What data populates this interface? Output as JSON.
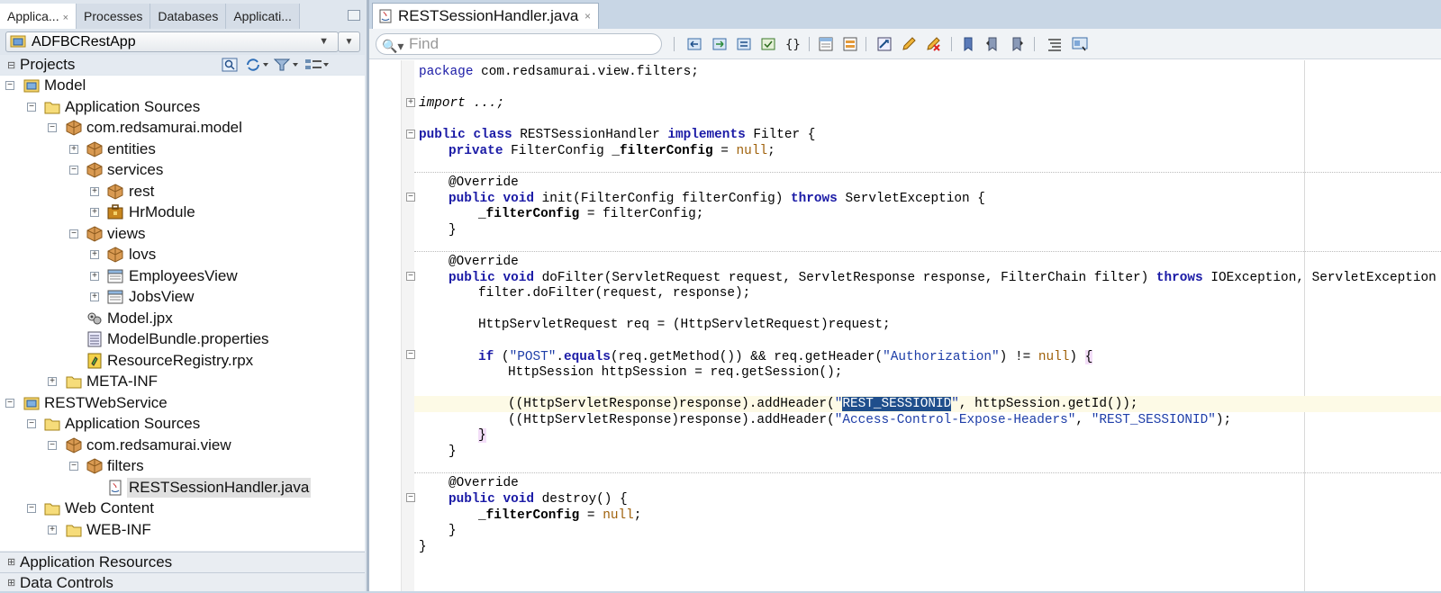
{
  "left_panel": {
    "tabs": [
      {
        "label": "Applica...",
        "active": true
      },
      {
        "label": "Processes"
      },
      {
        "label": "Databases"
      },
      {
        "label": "Applicati..."
      }
    ],
    "close_glyph": "×",
    "app_selector": "ADFBCRestApp",
    "projects_label": "Projects",
    "tree": [
      {
        "label": "Model",
        "icon": "project-icon",
        "expanded": true
      },
      {
        "label": "Application Sources",
        "icon": "folder-icon",
        "expanded": true
      },
      {
        "label": "com.redsamurai.model",
        "icon": "package-icon",
        "expanded": true
      },
      {
        "label": "entities",
        "icon": "package-icon",
        "expanded": false
      },
      {
        "label": "services",
        "icon": "package-icon",
        "expanded": true
      },
      {
        "label": "rest",
        "icon": "package-icon",
        "expanded": false
      },
      {
        "label": "HrModule",
        "icon": "app-module-icon",
        "expanded": false
      },
      {
        "label": "views",
        "icon": "package-icon",
        "expanded": true
      },
      {
        "label": "lovs",
        "icon": "package-icon",
        "expanded": false
      },
      {
        "label": "EmployeesView",
        "icon": "view-object-icon",
        "expanded": false
      },
      {
        "label": "JobsView",
        "icon": "view-object-icon",
        "expanded": false
      },
      {
        "label": "Model.jpx",
        "icon": "jpx-icon"
      },
      {
        "label": "ModelBundle.properties",
        "icon": "properties-icon"
      },
      {
        "label": "ResourceRegistry.rpx",
        "icon": "rpx-icon"
      },
      {
        "label": "META-INF",
        "icon": "folder-icon",
        "expanded": false
      },
      {
        "label": "RESTWebService",
        "icon": "project-icon",
        "expanded": true
      },
      {
        "label": "Application Sources",
        "icon": "folder-icon",
        "expanded": true
      },
      {
        "label": "com.redsamurai.view",
        "icon": "package-icon",
        "expanded": true
      },
      {
        "label": "filters",
        "icon": "package-icon",
        "expanded": true
      },
      {
        "label": "RESTSessionHandler.java",
        "icon": "java-file-icon",
        "selected": true
      },
      {
        "label": "Web Content",
        "icon": "folder-icon",
        "expanded": true
      },
      {
        "label": "WEB-INF",
        "icon": "folder-icon",
        "expanded": false
      }
    ],
    "bottom_sections": [
      "Application Resources",
      "Data Controls"
    ]
  },
  "editor": {
    "tab_label": "RESTSessionHandler.java",
    "find_placeholder": "Find",
    "code": {
      "l1_kw": "package",
      "l1_rest": " com.redsamurai.view.filters;",
      "l2": "import ...;",
      "l3_kw1": "public class",
      "l3_mid": " RESTSessionHandler ",
      "l3_kw2": "implements",
      "l3_end": " Filter {",
      "l4_kw": "private",
      "l4_type": " FilterConfig ",
      "l4_field": "_filterConfig",
      "l4_eq": " = ",
      "l4_null": "null",
      "l4_end": ";",
      "ann": "@Override",
      "l6_kw": "public void",
      "l6_mid": " init(FilterConfig filterConfig) ",
      "l6_kw2": "throws",
      "l6_end": " ServletException {",
      "l7_field": "_filterConfig",
      "l7_end": " = filterConfig;",
      "close": "}",
      "l10_kw": "public void",
      "l10_mid": " doFilter(ServletRequest request, ServletResponse response, FilterChain filter) ",
      "l10_kw2": "throws",
      "l10_end": " IOException, ServletException {",
      "l11": "filter.doFilter(request, response);",
      "l12": "HttpServletRequest req = (HttpServletRequest)request;",
      "l13_kw": "if",
      "l13_a": " (",
      "l13_s1": "\"POST\"",
      "l13_dot": ".",
      "l13_eq": "equals",
      "l13_b": "(req.getMethod()) && req.getHeader(",
      "l13_s2": "\"Authorization\"",
      "l13_c": ") != ",
      "l13_null": "null",
      "l13_d": ") ",
      "l13_brace": "{",
      "l14": "HttpSession httpSession = req.getSession();",
      "l15_a": "((HttpServletResponse)response).addHeader(",
      "l15_q1": "\"",
      "l15_sel": "REST_SESSIONID",
      "l15_q2": "\"",
      "l15_b": ", httpSession.getId());",
      "l16_a": "((HttpServletResponse)response).addHeader(",
      "l16_s1": "\"Access-Control-Expose-Headers\"",
      "l16_b": ", ",
      "l16_s2": "\"REST_SESSIONID\"",
      "l16_c": ");",
      "l17_brace": "}",
      "l20_kw": "public void",
      "l20_end": " destroy() {",
      "l21_field": "_filterConfig",
      "l21_eq": " = ",
      "l21_null": "null",
      "l21_end": ";"
    }
  }
}
